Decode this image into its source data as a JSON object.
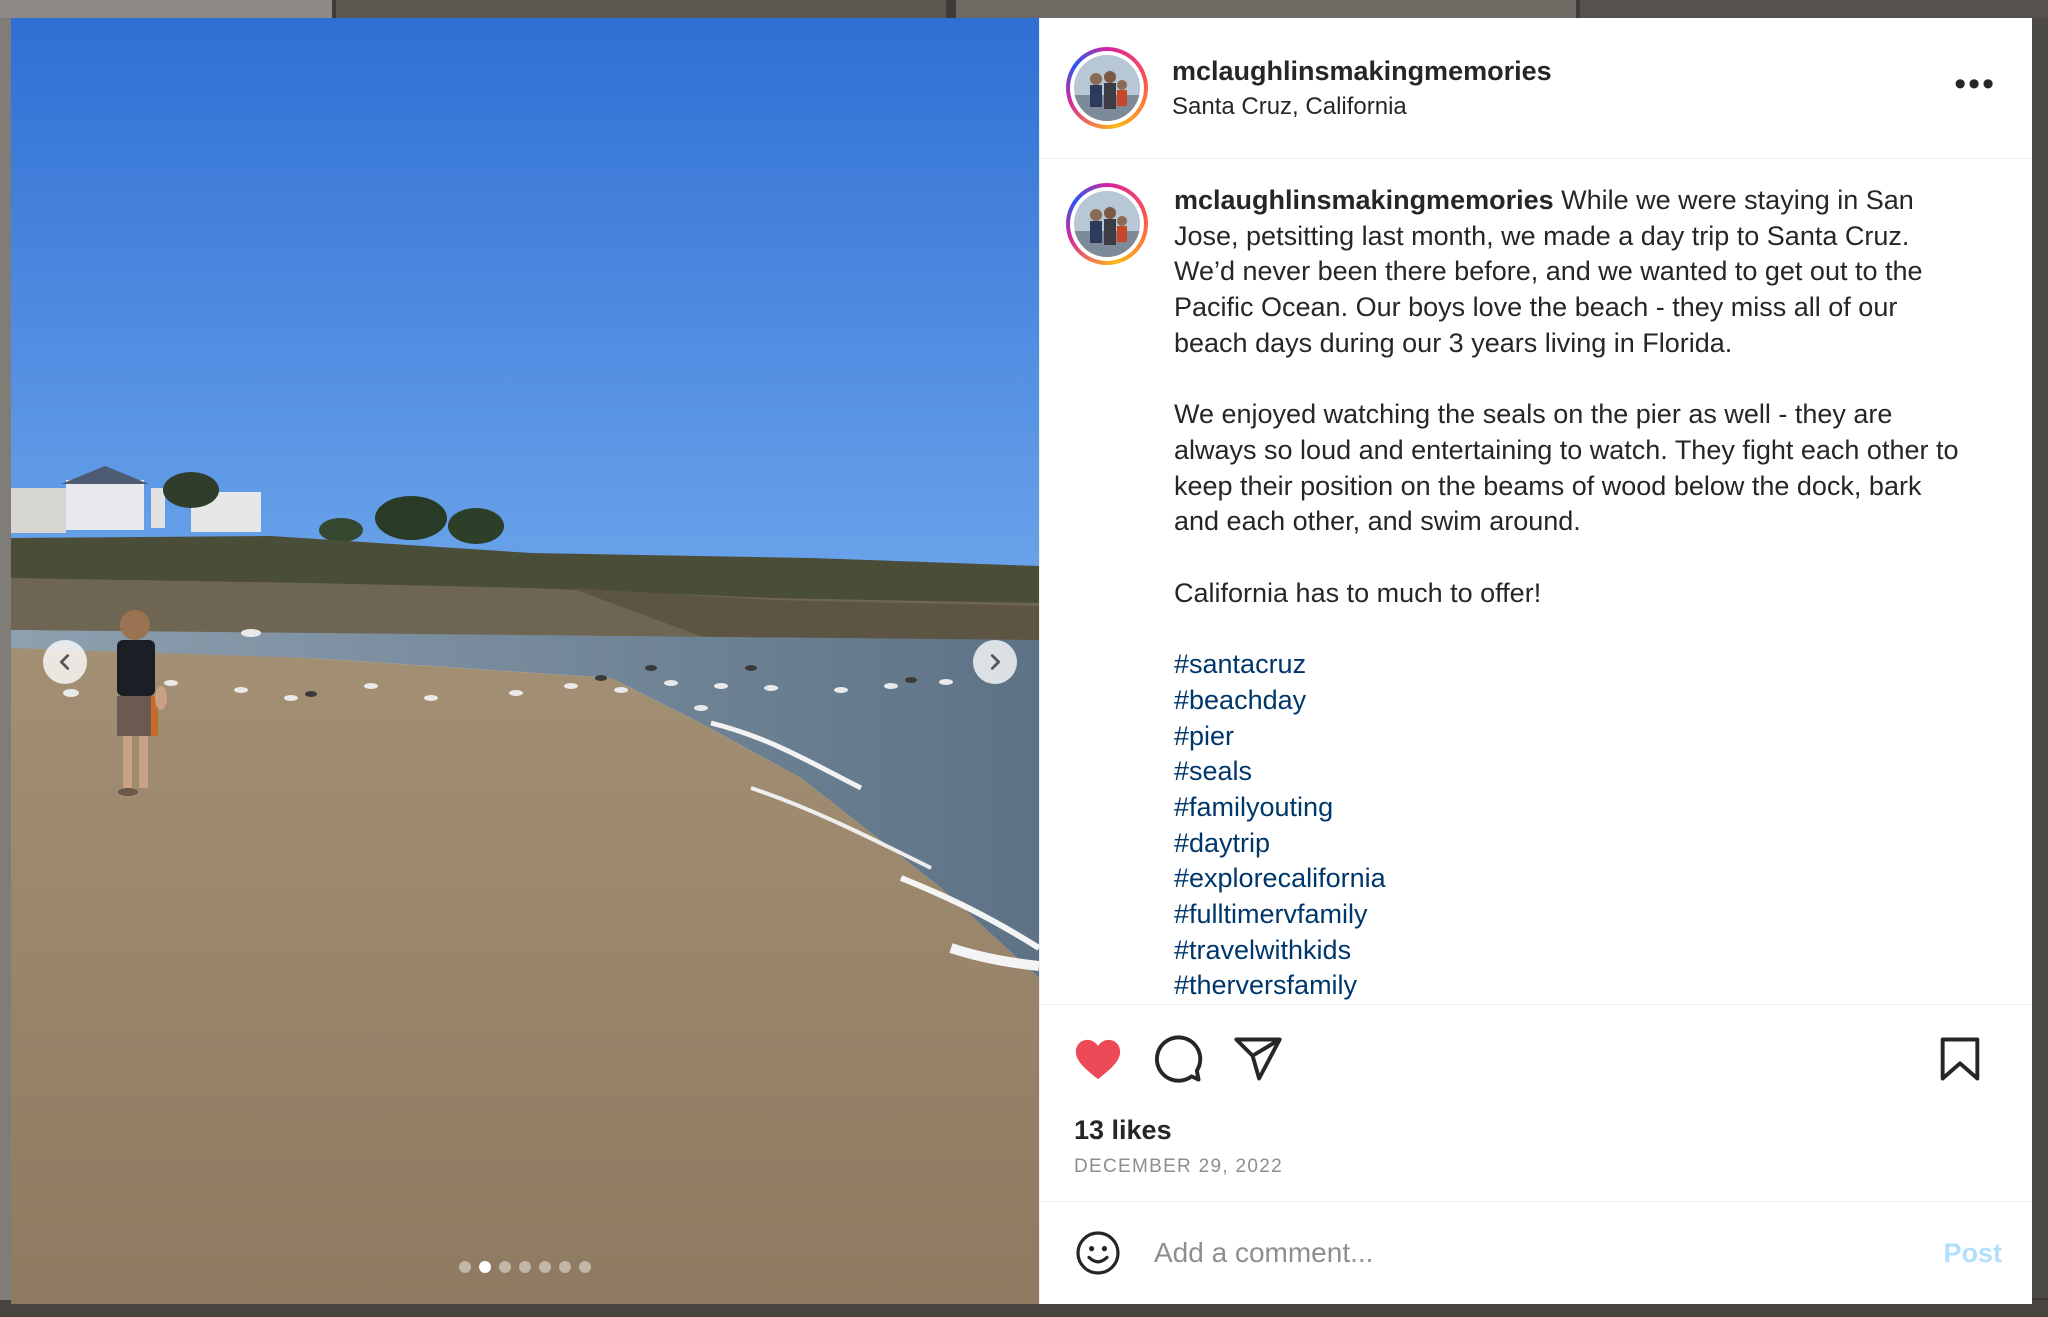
{
  "post": {
    "username": "mclaughlinsmakingmemories",
    "location": "Santa Cruz, California",
    "caption": {
      "username": "mclaughlinsmakingmemories",
      "p1": " While we were staying in San Jose, petsitting last month, we made a day trip to Santa Cruz. We’d never been there before, and we wanted to get out to the Pacific Ocean. Our boys love the beach - they miss all of our beach days during our 3 years living in Florida.",
      "p2": "We enjoyed watching the seals on the pier as well - they are always so loud and entertaining to watch. They fight each other to keep their position on the beams of wood below the dock, bark and each other, and swim around.",
      "p3": "California has to much to offer!",
      "hashtags": [
        "#santacruz",
        "#beachday",
        "#pier",
        "#seals",
        "#familyouting",
        "#daytrip",
        "#explorecalifornia",
        "#fulltimervfamily",
        "#travelwithkids",
        "#thervers​family"
      ]
    },
    "likes": "13 likes",
    "date": "DECEMBER 29, 2022",
    "comment_placeholder": "Add a comment...",
    "post_label": "Post",
    "more_label": "•••",
    "carousel": {
      "slides": 7,
      "active": 2
    }
  },
  "icons": {
    "like": "heart-filled-icon",
    "comment": "speech-bubble-icon",
    "share": "paper-plane-icon",
    "save": "bookmark-icon",
    "emoji": "smiley-icon",
    "more": "ellipsis-icon",
    "prev": "chevron-left-icon",
    "next": "chevron-right-icon"
  },
  "colors": {
    "like": "#ed4956",
    "link": "#00376b",
    "post_disabled": "#b2dffc",
    "meta": "#8e8e8e"
  }
}
